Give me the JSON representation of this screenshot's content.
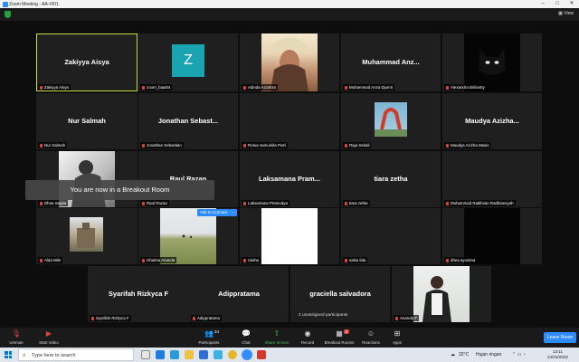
{
  "window": {
    "title": "Zoom Meeting - AA-VIII1"
  },
  "topbar": {
    "view_label": "View"
  },
  "tiles": [
    {
      "name": "Zakiyya Aisya",
      "big": "Zakiyya Aisya"
    },
    {
      "name": "zoom_baai04",
      "big": "Z"
    },
    {
      "name": "Adinda Azzahra",
      "big": ""
    },
    {
      "name": "Muhammad Anza Djumri",
      "big": "Muhammad  Anz..."
    },
    {
      "name": "Alexandra Briliantty",
      "big": ""
    },
    {
      "name": "Nur Salmah",
      "big": "Nur Salmah"
    },
    {
      "name": "Jonathan Sebastian",
      "big": "Jonathan  Sebast..."
    },
    {
      "name": "Rotua samuelita Putri",
      "big": ""
    },
    {
      "name": "Raja Sahali",
      "big": ""
    },
    {
      "name": "Maudya Azizha Masis",
      "big": "Maudya  Azizha..."
    },
    {
      "name": "Dhea Sagita",
      "big": ""
    },
    {
      "name": "Raul Razan",
      "big": "Raul Razan"
    },
    {
      "name": "Laksamana Pramudya",
      "big": "Laksamana  Pram..."
    },
    {
      "name": "tiara zetha",
      "big": "tiara zetha"
    },
    {
      "name": "Muhammad Raikhsan Radhiansyah",
      "big": ""
    },
    {
      "name": "Alda Mile",
      "big": ""
    },
    {
      "name": "Ghaitsa Ananda",
      "big": ""
    },
    {
      "name": "raisha",
      "big": ""
    },
    {
      "name": "salsa bila",
      "big": ""
    },
    {
      "name": "dhea ayustina",
      "big": ""
    },
    {
      "name": "Syarifah Rizkyca F",
      "big": "Syarifah Rizkyca F"
    },
    {
      "name": "Adippratama",
      "big": "Adippratama"
    },
    {
      "name": "graciella salvadora",
      "big": "graciella salvadora"
    },
    {
      "name": "Ananda F",
      "big": ""
    }
  ],
  "breakout_notice": "You are now in a Breakout Room",
  "ask_to_unmute": "Ask to Unmute",
  "more": "...",
  "unassigned_text": "2 unassigned participants",
  "toolbar": {
    "unmute": "Unmute",
    "start_video": "Start Video",
    "participants": "Participants",
    "participants_count": "24",
    "chat": "Chat",
    "share_screen": "Share Screen",
    "record": "Record",
    "breakout_rooms": "Breakout Rooms",
    "breakout_badge": "2",
    "reactions": "Reactions",
    "apps": "Apps",
    "leave": "Leave Room"
  },
  "taskbar": {
    "search_placeholder": "Type here to search",
    "temperature": "32°C",
    "weather": "Hujan ringan",
    "time": "13:11",
    "date": "24/03/2022"
  },
  "colors": {
    "accent": "#2d8cff",
    "active_speaker": "#c8e045",
    "muted": "#e0443a"
  }
}
